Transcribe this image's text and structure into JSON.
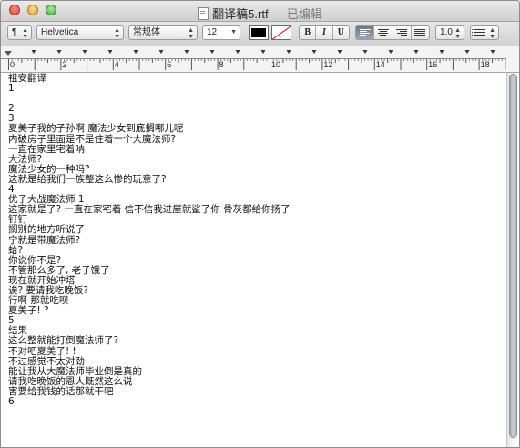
{
  "window": {
    "filename": "翻译稿5.rtf",
    "separator": " — ",
    "status": "已编辑"
  },
  "toolbar": {
    "paragraph_style": "¶",
    "font_family": "Helvetica",
    "typeface": "常规体",
    "font_size": "12",
    "bold_label": "B",
    "italic_label": "I",
    "underline_label": "U",
    "line_spacing": "1.0",
    "text_color": "#000000"
  },
  "ruler": {
    "labels": [
      "0",
      "2",
      "4",
      "6",
      "8",
      "10",
      "12",
      "14",
      "16",
      "18"
    ]
  },
  "document": {
    "lines": [
      "祖安翻译",
      "1",
      "",
      "2",
      "3",
      "夏美子我的子孙啊 魔法少女到底搁哪儿呢",
      "内破房子里面是不是住着一个大魔法师?",
      "一直在家里宅着呐",
      "大法师?",
      "魔法少女的一种吗?",
      "这就是给我们一族整这么惨的玩意了?",
      "4",
      "优子大战魔法师 1",
      "这家就是了? 一直在家宅着 信不信我进屋就鲨了你 骨灰都给你扬了",
      "钉钉",
      "搁别的地方听说了",
      "宁就是带魔法师?",
      "蛤?",
      "你说你不是?",
      "不管那么多了, 老子饿了",
      "现在就开始冲塔",
      "诶? 要请我吃晚饭?",
      "行啊 那就吃呗",
      "夏美子! ?",
      "5",
      "结果",
      "这么整就能打倒魔法师了?",
      "不对吧夏美子! !",
      "不过感觉不太对劲",
      "能让我从大魔法师毕业倒是真的",
      "请我吃晚饭的恩人既然这么说",
      "害要给我钱的话那就干吧",
      "6"
    ]
  }
}
